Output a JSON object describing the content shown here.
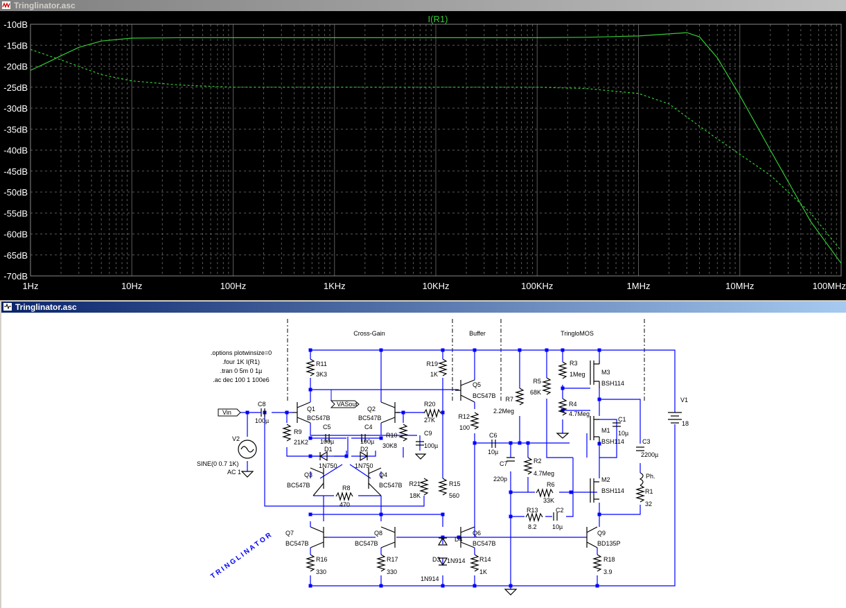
{
  "plot_window": {
    "title": "Tringlinator.asc",
    "trace_label": "I(R1)",
    "colors": {
      "background": "#000000",
      "grid": "#5a5a5a",
      "trace": "#33cc33",
      "axis_text": "#ffffff",
      "frame": "#000000"
    }
  },
  "chart_data": {
    "type": "line",
    "title": "I(R1)",
    "x_scale": "log",
    "x_ticks": [
      "1Hz",
      "10Hz",
      "100Hz",
      "1KHz",
      "10KHz",
      "100KHz",
      "1MHz",
      "10MHz",
      "100MHz"
    ],
    "y_ticks": [
      "-10dB",
      "-15dB",
      "-20dB",
      "-25dB",
      "-30dB",
      "-35dB",
      "-40dB",
      "-45dB",
      "-50dB",
      "-55dB",
      "-60dB",
      "-65dB",
      "-70dB"
    ],
    "xlim_hz": [
      1,
      100000000
    ],
    "ylim_db": [
      -70,
      -10
    ],
    "grid": true,
    "series": [
      {
        "style": "solid",
        "x": [
          1,
          1.5,
          2,
          3,
          5,
          10,
          30,
          100,
          1000,
          100000,
          300000,
          1000000,
          2000000,
          3000000,
          4000000,
          6000000,
          10000000,
          20000000,
          50000000,
          100000000
        ],
        "y": [
          -21,
          -19,
          -17.5,
          -15.5,
          -14,
          -13.3,
          -13.2,
          -13.2,
          -13.2,
          -13.2,
          -13.1,
          -12.8,
          -12.3,
          -12,
          -13,
          -18,
          -27,
          -40,
          -57,
          -67
        ]
      },
      {
        "style": "dashed",
        "x": [
          1,
          2,
          5,
          10,
          30,
          100,
          1000,
          100000,
          300000,
          1000000,
          2000000,
          5000000,
          10000000,
          20000000,
          50000000,
          100000000
        ],
        "y": [
          -16,
          -18.5,
          -22,
          -23.5,
          -24.5,
          -25,
          -25,
          -25,
          -25.3,
          -26.5,
          -29,
          -36,
          -41,
          -46,
          -55,
          -64
        ]
      }
    ]
  },
  "schematic_window": {
    "title": "Tringlinator.asc",
    "colors": {
      "wire": "#0000ff",
      "junction": "#0000ff",
      "component": "#000000",
      "text": "#000000",
      "background": "#ffffff",
      "block_divider": "#000000"
    },
    "section_labels": [
      "Cross-Gain",
      "Buffer",
      "TringloMOS"
    ],
    "directives": [
      ".options plotwinsize=0",
      ".four 1K I(R1)",
      ".tran 0 5m 0 1µ",
      ".ac dec 100 1 100e6"
    ],
    "input_label": "Vin",
    "output_label": "VASout",
    "signature": "T R I N G L I N A T O R",
    "components": {
      "r11": {
        "name": "R11",
        "value": "3K3"
      },
      "r19": {
        "name": "R19",
        "value": "1K"
      },
      "q5": {
        "name": "Q5",
        "value": "BC547B"
      },
      "c8": {
        "name": "C8",
        "value": "100µ"
      },
      "q1": {
        "name": "Q1",
        "value": "BC547B"
      },
      "q2": {
        "name": "Q2",
        "value": "BC547B"
      },
      "r20": {
        "name": "R20",
        "value": "27K"
      },
      "r9": {
        "name": "R9",
        "value": "21K2"
      },
      "c5": {
        "name": "C5",
        "value": "100µ"
      },
      "c4": {
        "name": "C4",
        "value": "100µ"
      },
      "r10": {
        "name": "R10",
        "value": "30K8"
      },
      "c9": {
        "name": "C9",
        "value": "100µ"
      },
      "d1": {
        "name": "D1",
        "value": "1N750"
      },
      "d2": {
        "name": "D2",
        "value": "1N750"
      },
      "v2": {
        "name": "V2",
        "value": "SINE(0 0.7 1K)",
        "ac": "AC 1"
      },
      "q3": {
        "name": "Q3",
        "value": "BC547B"
      },
      "q4": {
        "name": "Q4",
        "value": "BC547B"
      },
      "r8": {
        "name": "R8",
        "value": "470"
      },
      "r21": {
        "name": "R21",
        "value": "18K"
      },
      "r15": {
        "name": "R15",
        "value": "560"
      },
      "r12": {
        "name": "R12",
        "value": "100"
      },
      "c6": {
        "name": "C6",
        "value": "10µ"
      },
      "r7": {
        "name": "R7",
        "value": "2.2Meg"
      },
      "r5": {
        "name": "R5",
        "value": "68K"
      },
      "r3": {
        "name": "R3",
        "value": "1Meg"
      },
      "r4": {
        "name": "R4",
        "value": "4.7Meg"
      },
      "m3": {
        "name": "M3",
        "value": "BSH114"
      },
      "m1": {
        "name": "M1",
        "value": "BSH114"
      },
      "m2": {
        "name": "M2",
        "value": "BSH114"
      },
      "c1": {
        "name": "C1",
        "value": "10µ"
      },
      "c3": {
        "name": "C3",
        "value": "2200µ"
      },
      "ph": {
        "name": "Ph."
      },
      "r1": {
        "name": "R1",
        "value": "32"
      },
      "v1": {
        "name": "V1",
        "value": "18"
      },
      "c7": {
        "name": "C7",
        "value": "220p"
      },
      "r2": {
        "name": "R2",
        "value": "4.7Meg"
      },
      "r6": {
        "name": "R6",
        "value": "33K"
      },
      "r13": {
        "name": "R13",
        "value": "8.2"
      },
      "c2": {
        "name": "C2",
        "value": "10µ"
      },
      "q7": {
        "name": "Q7",
        "value": "BC547B"
      },
      "q8": {
        "name": "Q8",
        "value": "BC547B"
      },
      "q6": {
        "name": "Q6",
        "value": "BC547B"
      },
      "q9": {
        "name": "Q9",
        "value": "BD135P"
      },
      "r16": {
        "name": "R16",
        "value": "330"
      },
      "r17": {
        "name": "R17",
        "value": "330"
      },
      "d4": {
        "name": "D4",
        "value": "1N914"
      },
      "d3": {
        "name": "D3",
        "value": "1N914"
      },
      "r14": {
        "name": "R14",
        "value": "1K"
      },
      "r18": {
        "name": "R18",
        "value": "3.9"
      }
    }
  }
}
